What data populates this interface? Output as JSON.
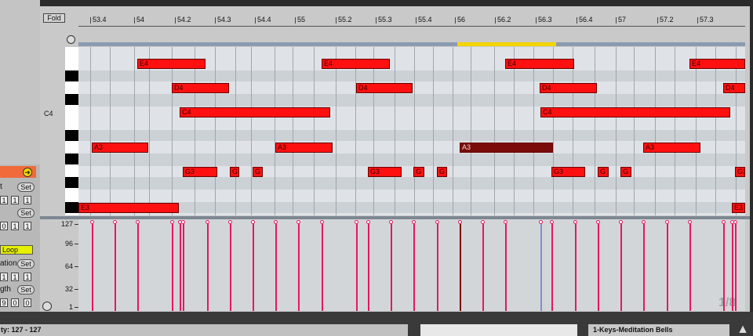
{
  "editor": {
    "fold_label": "Fold",
    "ruler": [
      "53.4",
      "54",
      "54.2",
      "54.3",
      "54.4",
      "55",
      "55.2",
      "55.3",
      "55.4",
      "56",
      "56.2",
      "56.3",
      "56.4",
      "57",
      "57.2",
      "57.3"
    ],
    "row_label": "C4",
    "notes": [
      {
        "label": "E4"
      },
      {
        "label": "E4"
      },
      {
        "label": "E4"
      },
      {
        "label": "E4"
      },
      {
        "label": "D4"
      },
      {
        "label": "D4"
      },
      {
        "label": "D4"
      },
      {
        "label": "D4"
      },
      {
        "label": "C4"
      },
      {
        "label": "C4"
      },
      {
        "label": "A3"
      },
      {
        "label": "A3"
      },
      {
        "label": "A3"
      },
      {
        "label": "A3"
      },
      {
        "label": "G3"
      },
      {
        "label": "G"
      },
      {
        "label": "G"
      },
      {
        "label": "G3"
      },
      {
        "label": "G"
      },
      {
        "label": "G"
      },
      {
        "label": "G3"
      },
      {
        "label": "G"
      },
      {
        "label": "G"
      },
      {
        "label": "G3"
      },
      {
        "label": "E3"
      },
      {
        "label": "E3"
      }
    ],
    "velocity_scale": [
      "127",
      "96",
      "64",
      "32",
      "1"
    ],
    "page_indicator": "1/8"
  },
  "left_panel": {
    "labels": [
      "t",
      "ation",
      "gth"
    ],
    "set_label": "Set",
    "loop_label": "Loop",
    "start_values": [
      "1",
      "1",
      "1"
    ],
    "end_values": [
      "0",
      "1",
      "1"
    ],
    "position_values": [
      "1",
      "1",
      "1"
    ],
    "length_values": [
      "9",
      "0",
      "0"
    ]
  },
  "statusbar": {
    "status_text": "ty: 127 - 127",
    "track_name": "1-Keys-Meditation Bells"
  },
  "colors": {
    "note": "#ff1010",
    "selected_note": "#7a0b0b",
    "velocity": "#e5185e",
    "loop_brace": "#f3d400"
  },
  "icons": [
    "headphone-icon",
    "arrow-right-icon",
    "play-icon",
    "triangle-icon"
  ]
}
